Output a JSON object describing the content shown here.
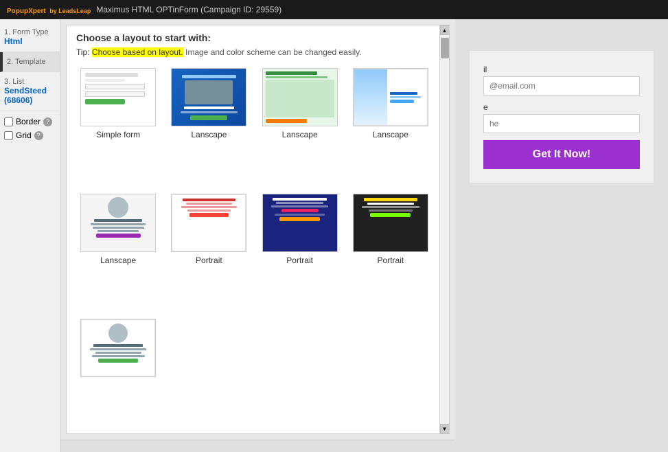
{
  "topbar": {
    "brand": "PopupXpert",
    "brand_sub": "by LeadsLeap",
    "title": "Maximus HTML OPTinForm (Campaign ID: 29559)"
  },
  "sidebar": {
    "items": [
      {
        "step": "1. Form Type",
        "value": "Html"
      },
      {
        "step": "2. Template",
        "value": ""
      },
      {
        "step": "3. List",
        "value": "SendSteed",
        "sub": "(68606)"
      }
    ],
    "checkboxes": [
      {
        "label": "Border",
        "checked": false
      },
      {
        "label": "Grid",
        "checked": false
      }
    ]
  },
  "layout_panel": {
    "heading": "Choose a layout to start with:",
    "tip_highlight": "Choose based on layout.",
    "tip_rest": " Image and color scheme can be changed easily.",
    "layouts": [
      {
        "id": 1,
        "label": "Simple form",
        "type": "simple"
      },
      {
        "id": 2,
        "label": "Lanscape",
        "type": "landscape1"
      },
      {
        "id": 3,
        "label": "Lanscape",
        "type": "landscape2"
      },
      {
        "id": 4,
        "label": "Lanscape",
        "type": "landscape3"
      },
      {
        "id": 5,
        "label": "Lanscape",
        "type": "landscape4"
      },
      {
        "id": 6,
        "label": "Portrait",
        "type": "portrait1"
      },
      {
        "id": 7,
        "label": "Portrait",
        "type": "portrait2"
      },
      {
        "id": 8,
        "label": "Portrait",
        "type": "portrait3"
      },
      {
        "id": 9,
        "label": "",
        "type": "last"
      }
    ]
  },
  "preview": {
    "email_label": "il",
    "email_placeholder": "@email.com",
    "name_label": "e",
    "name_placeholder": "he",
    "submit_label": "Get It Now!"
  }
}
